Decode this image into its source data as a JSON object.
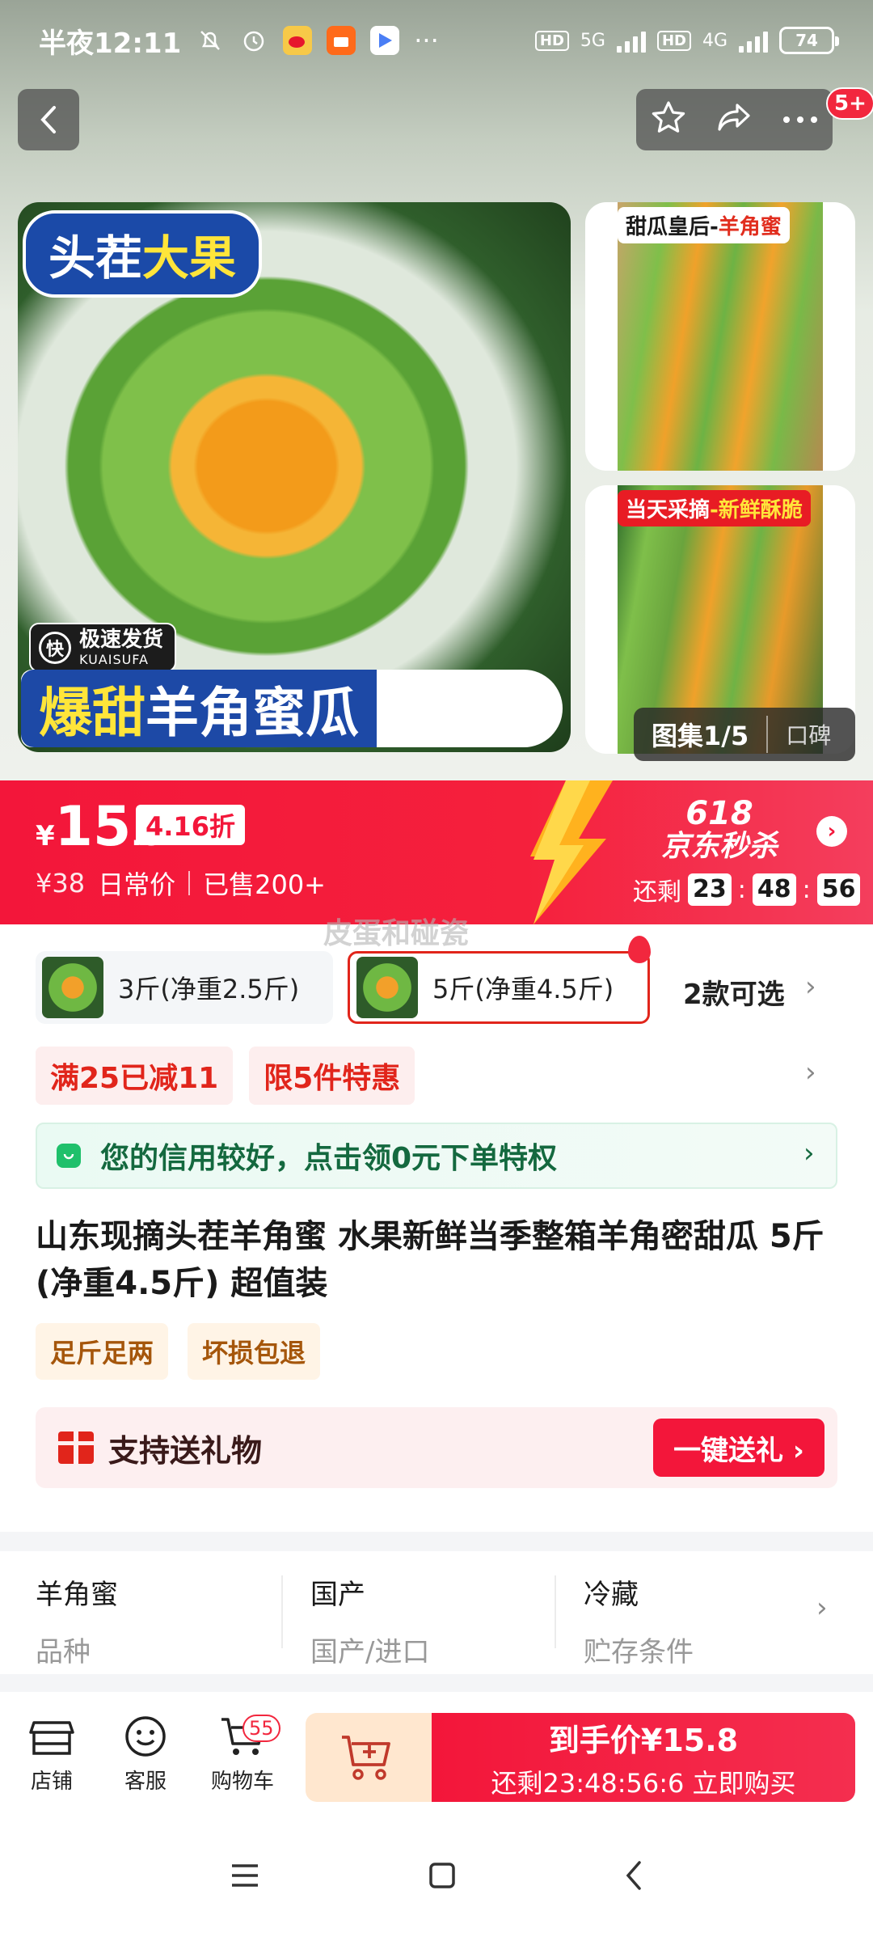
{
  "status_bar": {
    "time": "半夜12:11",
    "net1": "5G",
    "net2": "4G",
    "hd": "HD",
    "battery": "74",
    "more": "···"
  },
  "top_actions": {
    "badge": "5+"
  },
  "gallery": {
    "main_tag_a": "头茬",
    "main_tag_b": "大果",
    "shipping_cn": "极速发货",
    "shipping_en": "KUAISUFA",
    "shipping_icon": "快",
    "banner_a": "爆甜",
    "banner_b": "羊角蜜瓜",
    "side1_caption_a": "甜瓜皇后-",
    "side1_caption_b": "羊角蜜",
    "side2_caption_a": "当天采摘",
    "side2_caption_b": "-新鲜酥脆",
    "counter": "图集1/5",
    "reviews": "口碑"
  },
  "price": {
    "currency": "¥",
    "integer": "15",
    "decimal": ".8",
    "discount": "4.16折",
    "original": "¥38",
    "original_label": "日常价",
    "sold": "已售200+",
    "deal_line1": "618",
    "deal_line2": "京东秒杀",
    "remaining_label": "还剩",
    "hh": "23",
    "mm": "48",
    "ss": "56",
    "colon": ":"
  },
  "watermark": "皮蛋和碰瓷",
  "variants": {
    "items": [
      {
        "label": "3斤(净重2.5斤)"
      },
      {
        "label": "5斤(净重4.5斤)"
      }
    ],
    "more": "2款可选"
  },
  "promos": [
    "满25已减11",
    "限5件特惠"
  ],
  "credit": {
    "text": "您的信用较好，点击领0元下单特权"
  },
  "product": {
    "title": "山东现摘头茬羊角蜜 水果新鲜当季整箱羊角密甜瓜 5斤(净重4.5斤) 超值装",
    "tags": [
      "足斤足两",
      "坏损包退"
    ]
  },
  "gift": {
    "label": "支持送礼物",
    "button": "一键送礼 ›"
  },
  "specs": [
    {
      "value": "羊角蜜",
      "key": "品种"
    },
    {
      "value": "国产",
      "key": "国产/进口"
    },
    {
      "value": "冷藏",
      "key": "贮存条件"
    }
  ],
  "bottom_nav": {
    "store": "店铺",
    "service": "客服",
    "cart": "购物车",
    "cart_count": "55",
    "buy_line1": "到手价¥15.8",
    "buy_line2": "还剩23:48:56:6 立即购买"
  },
  "colors": {
    "accent": "#f3163a",
    "credit_green": "#1fc06b",
    "tag_brown": "#a5560b"
  }
}
